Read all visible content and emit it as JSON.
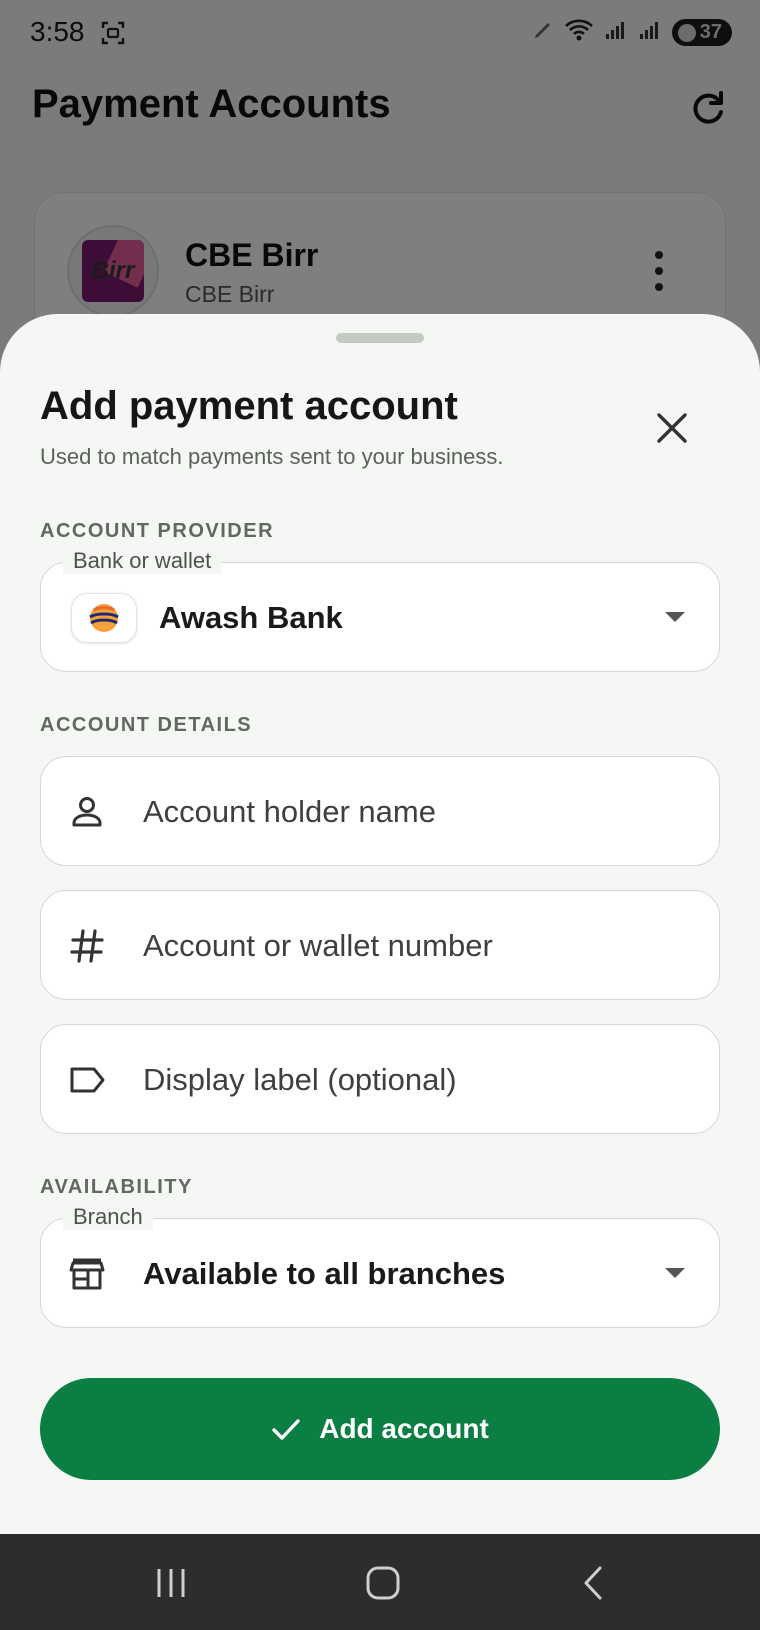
{
  "status_bar": {
    "time": "3:58",
    "battery": "37"
  },
  "app": {
    "title": "Payment Accounts",
    "accounts": [
      {
        "name": "CBE Birr",
        "provider": "CBE Birr",
        "logo_text": "Birr"
      }
    ]
  },
  "sheet": {
    "title": "Add payment account",
    "subtitle": "Used to match payments sent to your business.",
    "provider_section_label": "ACCOUNT PROVIDER",
    "provider_field": {
      "legend": "Bank or wallet",
      "value": "Awash Bank"
    },
    "details_section_label": "ACCOUNT DETAILS",
    "holder_field": {
      "placeholder": "Account holder name",
      "icon": "person-icon"
    },
    "number_field": {
      "placeholder": "Account or wallet number",
      "icon": "hash-icon"
    },
    "label_field": {
      "placeholder": "Display label (optional)",
      "icon": "label-icon"
    },
    "availability_section_label": "AVAILABILITY",
    "branch_field": {
      "legend": "Branch",
      "value": "Available to all branches",
      "icon": "store-icon"
    },
    "submit_label": "Add account"
  },
  "colors": {
    "primary": "#0b7e44",
    "sheet_bg": "#f5f7f4",
    "nav_bg": "#2d2d2d"
  }
}
